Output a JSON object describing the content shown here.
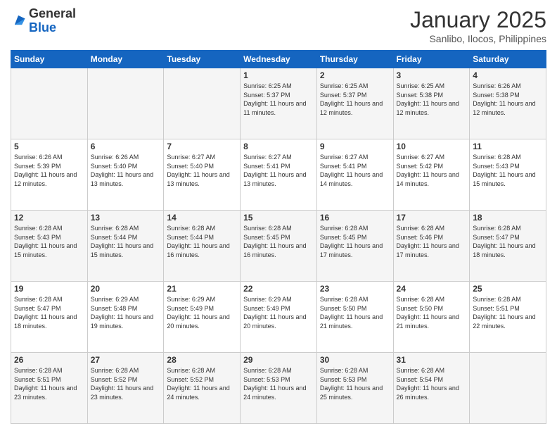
{
  "header": {
    "logo": {
      "general": "General",
      "blue": "Blue"
    },
    "title": "January 2025",
    "subtitle": "Sanlibo, Ilocos, Philippines"
  },
  "weekdays": [
    "Sunday",
    "Monday",
    "Tuesday",
    "Wednesday",
    "Thursday",
    "Friday",
    "Saturday"
  ],
  "weeks": [
    [
      {
        "day": "",
        "sunrise": "",
        "sunset": "",
        "daylight": ""
      },
      {
        "day": "",
        "sunrise": "",
        "sunset": "",
        "daylight": ""
      },
      {
        "day": "",
        "sunrise": "",
        "sunset": "",
        "daylight": ""
      },
      {
        "day": "1",
        "sunrise": "6:25 AM",
        "sunset": "5:37 PM",
        "daylight": "11 hours and 11 minutes."
      },
      {
        "day": "2",
        "sunrise": "6:25 AM",
        "sunset": "5:37 PM",
        "daylight": "11 hours and 12 minutes."
      },
      {
        "day": "3",
        "sunrise": "6:25 AM",
        "sunset": "5:38 PM",
        "daylight": "11 hours and 12 minutes."
      },
      {
        "day": "4",
        "sunrise": "6:26 AM",
        "sunset": "5:38 PM",
        "daylight": "11 hours and 12 minutes."
      }
    ],
    [
      {
        "day": "5",
        "sunrise": "6:26 AM",
        "sunset": "5:39 PM",
        "daylight": "11 hours and 12 minutes."
      },
      {
        "day": "6",
        "sunrise": "6:26 AM",
        "sunset": "5:40 PM",
        "daylight": "11 hours and 13 minutes."
      },
      {
        "day": "7",
        "sunrise": "6:27 AM",
        "sunset": "5:40 PM",
        "daylight": "11 hours and 13 minutes."
      },
      {
        "day": "8",
        "sunrise": "6:27 AM",
        "sunset": "5:41 PM",
        "daylight": "11 hours and 13 minutes."
      },
      {
        "day": "9",
        "sunrise": "6:27 AM",
        "sunset": "5:41 PM",
        "daylight": "11 hours and 14 minutes."
      },
      {
        "day": "10",
        "sunrise": "6:27 AM",
        "sunset": "5:42 PM",
        "daylight": "11 hours and 14 minutes."
      },
      {
        "day": "11",
        "sunrise": "6:28 AM",
        "sunset": "5:43 PM",
        "daylight": "11 hours and 15 minutes."
      }
    ],
    [
      {
        "day": "12",
        "sunrise": "6:28 AM",
        "sunset": "5:43 PM",
        "daylight": "11 hours and 15 minutes."
      },
      {
        "day": "13",
        "sunrise": "6:28 AM",
        "sunset": "5:44 PM",
        "daylight": "11 hours and 15 minutes."
      },
      {
        "day": "14",
        "sunrise": "6:28 AM",
        "sunset": "5:44 PM",
        "daylight": "11 hours and 16 minutes."
      },
      {
        "day": "15",
        "sunrise": "6:28 AM",
        "sunset": "5:45 PM",
        "daylight": "11 hours and 16 minutes."
      },
      {
        "day": "16",
        "sunrise": "6:28 AM",
        "sunset": "5:45 PM",
        "daylight": "11 hours and 17 minutes."
      },
      {
        "day": "17",
        "sunrise": "6:28 AM",
        "sunset": "5:46 PM",
        "daylight": "11 hours and 17 minutes."
      },
      {
        "day": "18",
        "sunrise": "6:28 AM",
        "sunset": "5:47 PM",
        "daylight": "11 hours and 18 minutes."
      }
    ],
    [
      {
        "day": "19",
        "sunrise": "6:28 AM",
        "sunset": "5:47 PM",
        "daylight": "11 hours and 18 minutes."
      },
      {
        "day": "20",
        "sunrise": "6:29 AM",
        "sunset": "5:48 PM",
        "daylight": "11 hours and 19 minutes."
      },
      {
        "day": "21",
        "sunrise": "6:29 AM",
        "sunset": "5:49 PM",
        "daylight": "11 hours and 20 minutes."
      },
      {
        "day": "22",
        "sunrise": "6:29 AM",
        "sunset": "5:49 PM",
        "daylight": "11 hours and 20 minutes."
      },
      {
        "day": "23",
        "sunrise": "6:28 AM",
        "sunset": "5:50 PM",
        "daylight": "11 hours and 21 minutes."
      },
      {
        "day": "24",
        "sunrise": "6:28 AM",
        "sunset": "5:50 PM",
        "daylight": "11 hours and 21 minutes."
      },
      {
        "day": "25",
        "sunrise": "6:28 AM",
        "sunset": "5:51 PM",
        "daylight": "11 hours and 22 minutes."
      }
    ],
    [
      {
        "day": "26",
        "sunrise": "6:28 AM",
        "sunset": "5:51 PM",
        "daylight": "11 hours and 23 minutes."
      },
      {
        "day": "27",
        "sunrise": "6:28 AM",
        "sunset": "5:52 PM",
        "daylight": "11 hours and 23 minutes."
      },
      {
        "day": "28",
        "sunrise": "6:28 AM",
        "sunset": "5:52 PM",
        "daylight": "11 hours and 24 minutes."
      },
      {
        "day": "29",
        "sunrise": "6:28 AM",
        "sunset": "5:53 PM",
        "daylight": "11 hours and 24 minutes."
      },
      {
        "day": "30",
        "sunrise": "6:28 AM",
        "sunset": "5:53 PM",
        "daylight": "11 hours and 25 minutes."
      },
      {
        "day": "31",
        "sunrise": "6:28 AM",
        "sunset": "5:54 PM",
        "daylight": "11 hours and 26 minutes."
      },
      {
        "day": "",
        "sunrise": "",
        "sunset": "",
        "daylight": ""
      }
    ]
  ]
}
